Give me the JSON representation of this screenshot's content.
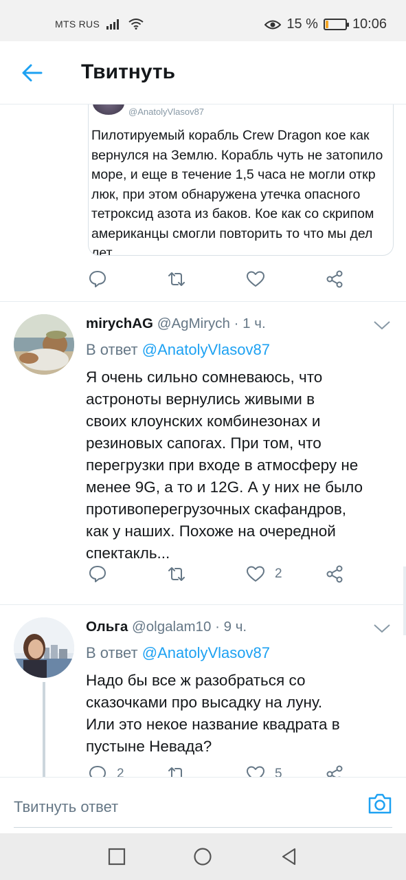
{
  "status_bar": {
    "carrier": "MTS RUS",
    "battery": "15 %",
    "battery_level": 0.15,
    "time": "10:06",
    "battery_color": "#f5a623"
  },
  "app_bar": {
    "title": "Твитнуть",
    "back_icon": "arrow-left-icon",
    "accent": "#1da1f2"
  },
  "quoted_tweet": {
    "handle": "@AnatolyVlasov87",
    "text": "Пилотируемый корабль Crew Dragon кое как\nвернулся на Землю. Корабль чуть не затопило\nморе, и еще в течение 1,5 часа не могли откр\nлюк, при этом обнаружена утечка опасного\nтетроксид азота из баков. Кое как со скрипом\nамериканцы смогли повторить то что мы дел\nлет.",
    "actions": {
      "like_count": ""
    }
  },
  "replies": [
    {
      "name": "mirychAG",
      "handle": "@AgMirych",
      "time": "1 ч.",
      "reply_prefix": "В ответ",
      "reply_to": "@AnatolyVlasov87",
      "text": "Я очень сильно сомневаюсь, что\nастроноты вернулись живыми в\nсвоих клоунских комбинезонах и\nрезиновых сапогах. При том, что\nперегрузки при входе в атмосферу не\nменее 9G, а то и 12G. А у них не было\nпротивоперегрузочных скафандров,\nкак у наших. Похоже на очередной\nспектакль...",
      "reply_count": "",
      "retweet_count": "",
      "like_count": "2"
    },
    {
      "name": "Ольга",
      "handle": "@olgalam10",
      "time": "9 ч.",
      "reply_prefix": "В ответ",
      "reply_to": "@AnatolyVlasov87",
      "text": "Надо бы все ж разобраться со\nсказочками про высадку на луну.\nИли это некое название квадрата в\nпустыне Невада?",
      "reply_count": "2",
      "retweet_count": "",
      "like_count": "5"
    }
  ],
  "composer": {
    "placeholder": "Твитнуть ответ",
    "camera_icon": "camera-icon"
  },
  "nav_bar": {
    "buttons": [
      "square-icon",
      "circle-icon",
      "triangle-back-icon"
    ]
  }
}
